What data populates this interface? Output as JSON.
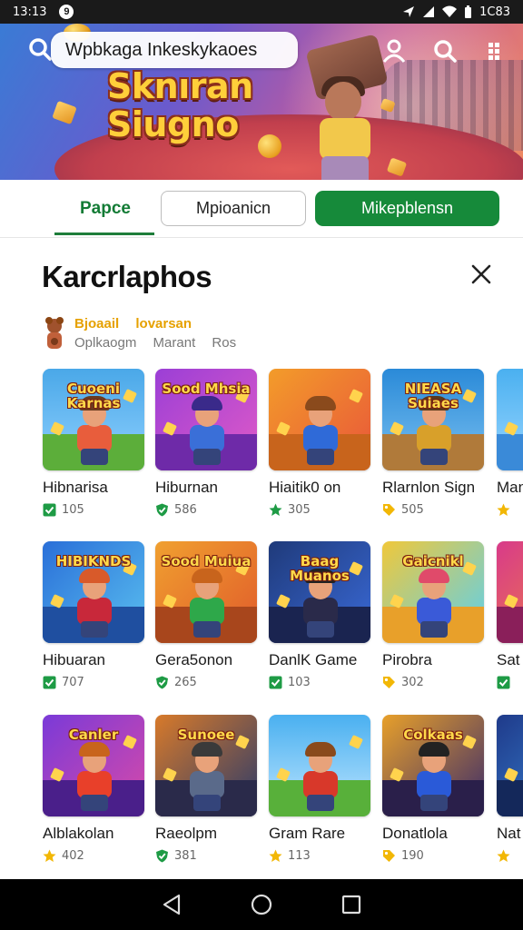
{
  "status_bar": {
    "time": "13:13",
    "notification_badge": "9",
    "battery_text": "1C83"
  },
  "banner": {
    "search_text": "Wpbkaga Inkeskykaoes",
    "art_title_line1": "Sknıran",
    "art_title_line2": "Siugno"
  },
  "tabs": {
    "tab1": "Papce",
    "tab2": "Mpioanicn",
    "tab3": "Mikepblensn"
  },
  "section": {
    "title": "Karcrlaphos",
    "developer_line1": [
      "Bjoaail",
      "lovarsan"
    ],
    "developer_line2": [
      "Oplkaogm",
      "Marant",
      "Ros"
    ]
  },
  "games": [
    {
      "name": "Hibnarisa",
      "rating": "105",
      "badge": "green-check",
      "art": "Cuoeni Karnas",
      "theme": "meadow"
    },
    {
      "name": "Hiburnan",
      "rating": "586",
      "badge": "green-shield",
      "art": "Sood Mhsia",
      "theme": "purple"
    },
    {
      "name": "Hiaitik0 on",
      "rating": "305",
      "badge": "green-star",
      "art": "",
      "theme": "orange"
    },
    {
      "name": "Rlarnlon Sign",
      "rating": "505",
      "badge": "gold-tag",
      "art": "NIEASA Suiaes",
      "theme": "town"
    },
    {
      "name": "Man",
      "rating": "",
      "badge": "gold-star",
      "art": "Sc",
      "theme": "sky"
    },
    {
      "name": "Hibuaran",
      "rating": "707",
      "badge": "green-check",
      "art": "HIBIKNDS",
      "theme": "blue"
    },
    {
      "name": "Gera5onon",
      "rating": "265",
      "badge": "green-shield",
      "art": "Sood Muiua",
      "theme": "sunset"
    },
    {
      "name": "DanlK Game",
      "rating": "103",
      "badge": "green-check",
      "art": "Baag Muanos",
      "theme": "night"
    },
    {
      "name": "Pirobra",
      "rating": "302",
      "badge": "gold-tag",
      "art": "Gaicnikl",
      "theme": "bright"
    },
    {
      "name": "Sat",
      "rating": "",
      "badge": "green-check",
      "art": "",
      "theme": "magenta"
    },
    {
      "name": "Alblakolan",
      "rating": "402",
      "badge": "gold-star",
      "art": "Canler",
      "theme": "purple2"
    },
    {
      "name": "Raeolpm",
      "rating": "381",
      "badge": "green-shield",
      "art": "Sunoee",
      "theme": "dusk"
    },
    {
      "name": "Gram Rare",
      "rating": "113",
      "badge": "gold-star",
      "art": "",
      "theme": "field"
    },
    {
      "name": "Donatlola",
      "rating": "190",
      "badge": "gold-tag",
      "art": "Colkaas",
      "theme": "crew"
    },
    {
      "name": "Nat",
      "rating": "",
      "badge": "gold-star",
      "art": "",
      "theme": "navy"
    }
  ],
  "colors": {
    "accent_green": "#168a3a",
    "tab_text_green": "#137b35",
    "rating_gold": "#f2b705"
  }
}
